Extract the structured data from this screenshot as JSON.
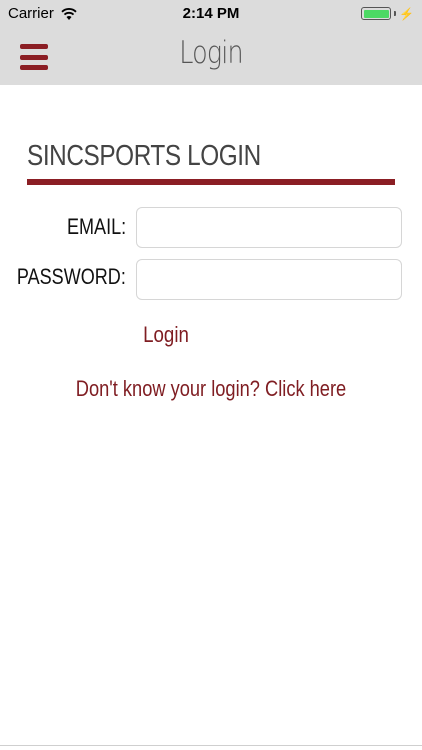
{
  "status_bar": {
    "carrier": "Carrier",
    "time": "2:14 PM",
    "wifi_icon": "wifi-icon",
    "battery_icon": "battery-icon",
    "battery_level": 1.0,
    "charging_icon": "bolt-icon"
  },
  "nav": {
    "title": "Login",
    "menu_icon": "hamburger-menu-icon"
  },
  "login": {
    "section_title": "SINCSPORTS LOGIN",
    "email_label": "EMAIL:",
    "email_value": "",
    "password_label": "PASSWORD:",
    "password_value": "",
    "login_button": "Login",
    "forgot_link": "Don't know your login? Click here"
  },
  "colors": {
    "accent": "#8b1e24",
    "bar_background": "#dcdcdc",
    "battery_fill": "#4cd964"
  }
}
